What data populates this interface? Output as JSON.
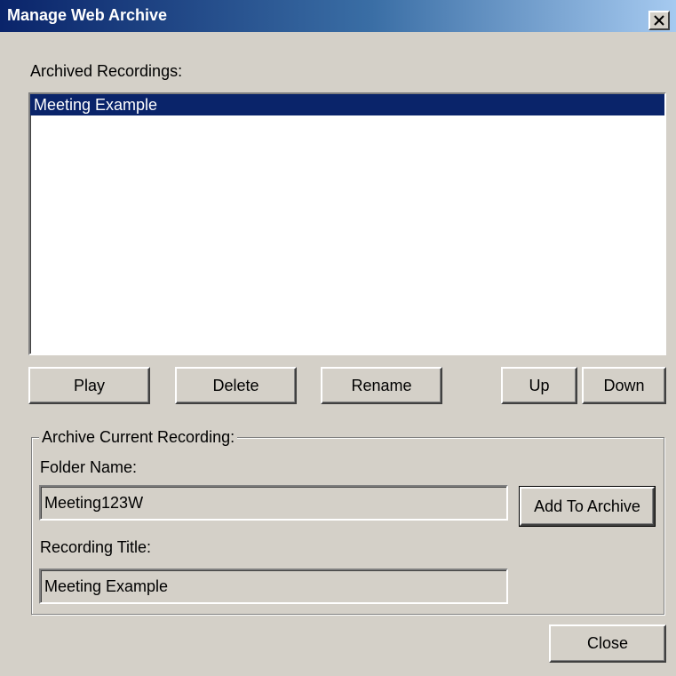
{
  "window": {
    "title": "Manage Web Archive",
    "close_glyph": "✕"
  },
  "archived": {
    "label": "Archived Recordings:",
    "items": [
      {
        "label": "Meeting Example",
        "selected": true
      }
    ]
  },
  "actions": {
    "play": "Play",
    "delete": "Delete",
    "rename": "Rename",
    "up": "Up",
    "down": "Down"
  },
  "current": {
    "group_label": "Archive Current Recording:",
    "folder_label": "Folder Name:",
    "folder_value": "Meeting123W",
    "add_button": "Add To Archive",
    "title_label": "Recording Title:",
    "title_value": "Meeting Example"
  },
  "footer": {
    "close": "Close"
  },
  "colors": {
    "dialog_bg": "#d4d0c8",
    "titlebar_start": "#0a246a",
    "titlebar_end": "#a6caf0",
    "selection_bg": "#0a246a"
  }
}
